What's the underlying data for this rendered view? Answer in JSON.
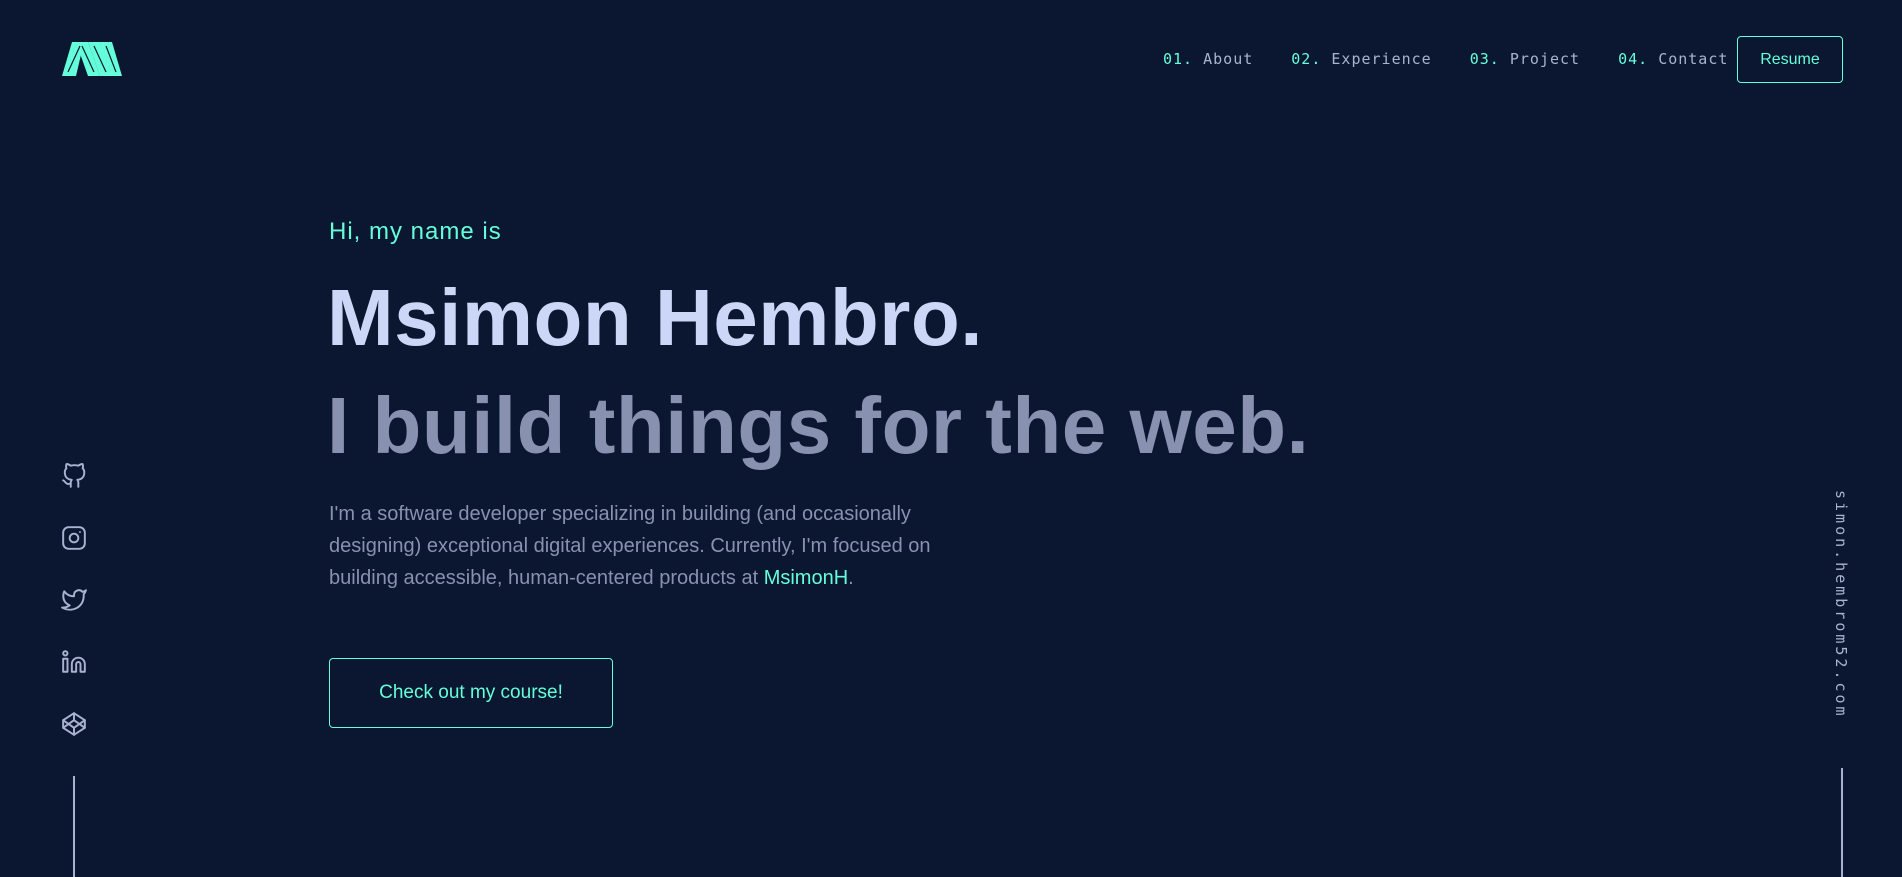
{
  "header": {
    "logo_icon": "m-logo-icon",
    "nav": [
      {
        "num": "01.",
        "label": "About"
      },
      {
        "num": "02.",
        "label": "Experience"
      },
      {
        "num": "03.",
        "label": "Project"
      },
      {
        "num": "04.",
        "label": "Contact"
      }
    ],
    "resume_label": "Resume"
  },
  "hero": {
    "greeting": "Hi, my name is",
    "name": "Msimon Hembro.",
    "tagline": "I build things for the web.",
    "bio_text": "I'm a software developer specializing in building (and occasionally designing) exceptional digital experiences. Currently, I'm focused on building accessible, human-centered products at ",
    "bio_link": "MsimonH",
    "bio_end": ".",
    "cta_label": "Check out my course!"
  },
  "social": {
    "icons": [
      "github-icon",
      "instagram-icon",
      "twitter-icon",
      "linkedin-icon",
      "codepen-icon"
    ]
  },
  "email": "simon.hembrom52.com",
  "colors": {
    "background": "#0b1730",
    "accent": "#64ffda",
    "heading": "#ccd6f6",
    "text": "#8892b0",
    "nav_text": "#a8b3cf"
  }
}
